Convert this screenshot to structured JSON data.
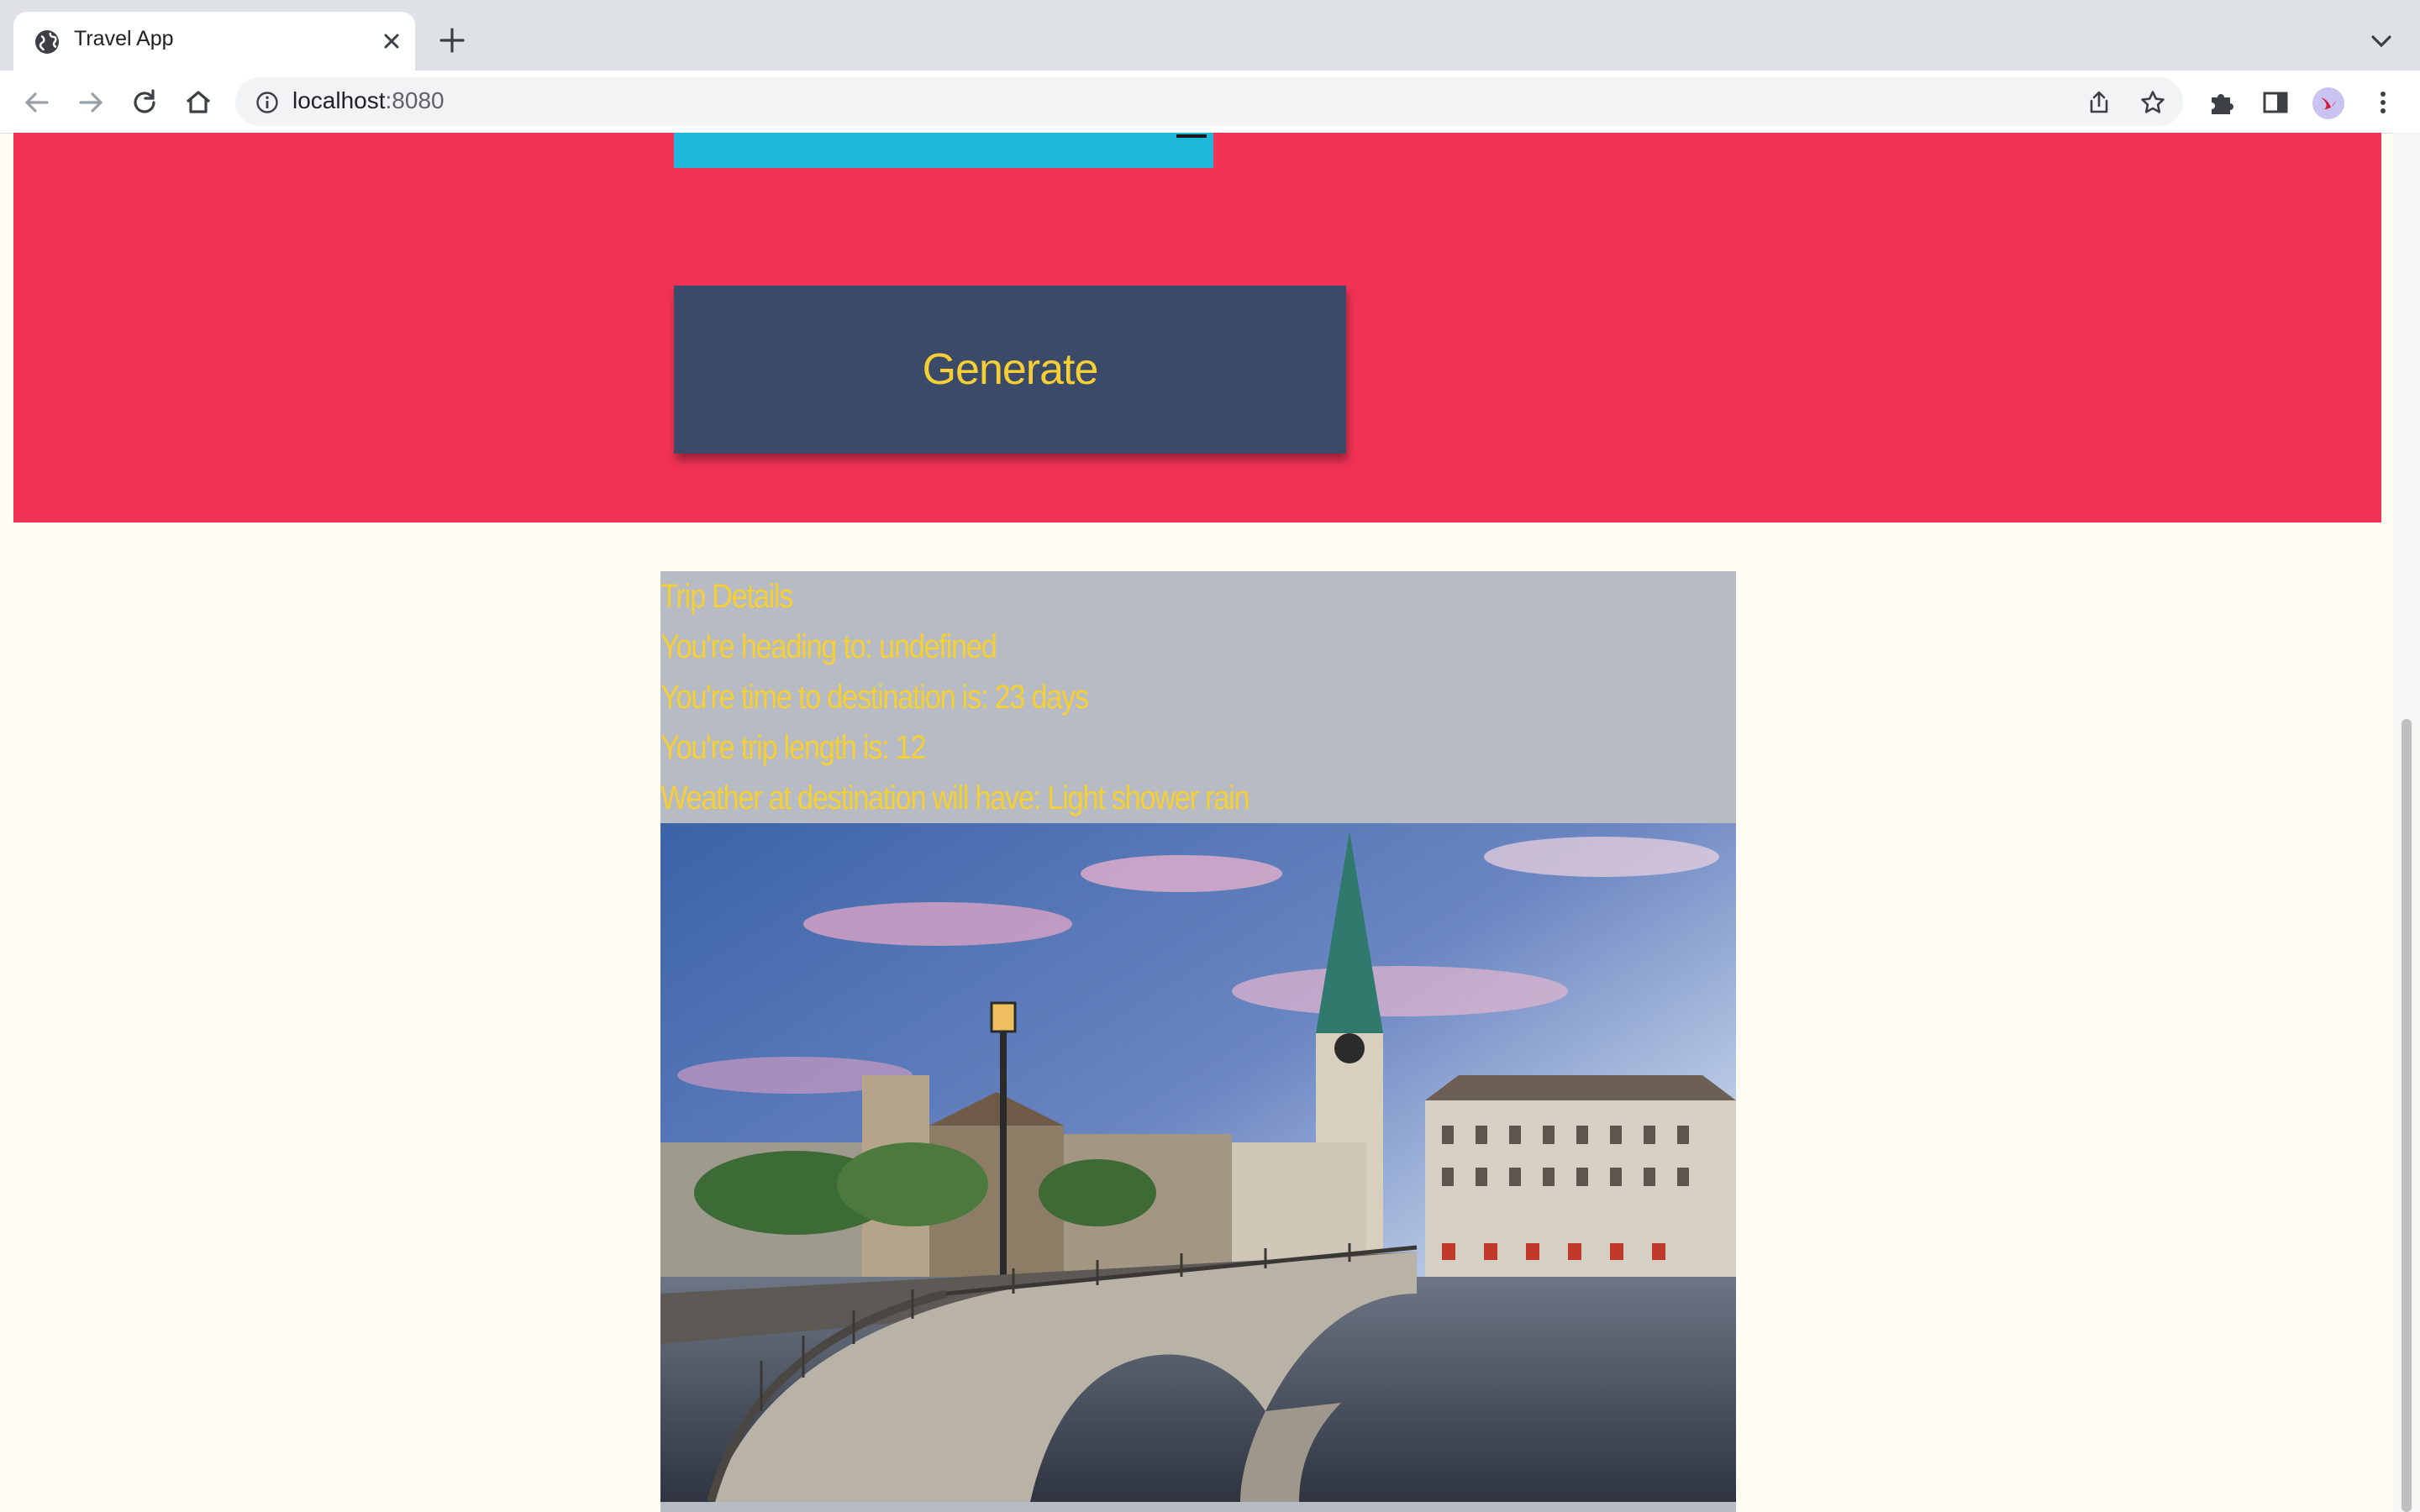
{
  "browser": {
    "tab": {
      "title": "Travel App"
    },
    "address": {
      "host": "localhost",
      "port": ":8080"
    }
  },
  "page": {
    "generate_label": "Generate",
    "trip": {
      "heading": "Trip Details",
      "destination": "You're heading to: undefined",
      "time_to_destination": "You're time to destination is: 23 days",
      "trip_length": "You're trip length is: 12",
      "weather": "Weather at destination will have: Light shower rain"
    },
    "image": {
      "subject": "city-bridge-photo"
    }
  },
  "colors": {
    "hero_bg": "#f23355",
    "button_bg": "#3c4a69",
    "accent_text": "#f5cf33",
    "input_bg": "#1fb8da",
    "results_bg": "#b6bbc4",
    "page_bg": "#fffdf3"
  }
}
